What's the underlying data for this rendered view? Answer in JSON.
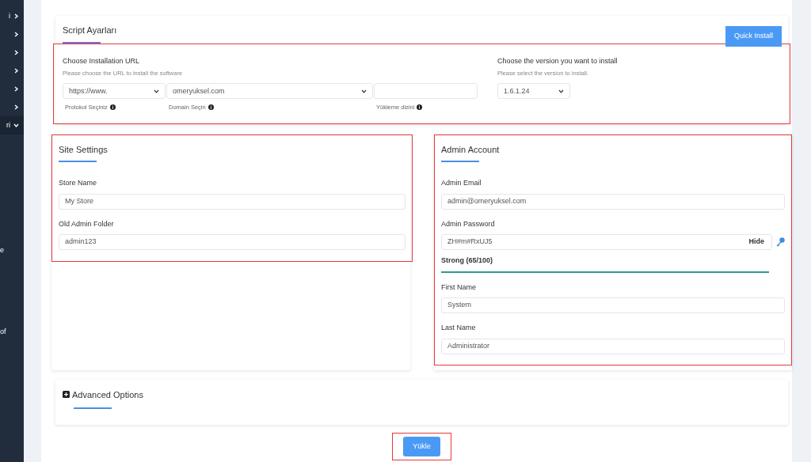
{
  "sidebar": {
    "items": [
      {
        "kind": "menu",
        "label": "i",
        "expanded": false
      },
      {
        "kind": "menu",
        "expanded": false
      },
      {
        "kind": "menu",
        "expanded": false
      },
      {
        "kind": "menu",
        "expanded": false
      },
      {
        "kind": "menu",
        "expanded": false
      },
      {
        "kind": "menu",
        "expanded": false
      },
      {
        "kind": "menu",
        "label": "ri",
        "expanded": true
      },
      {
        "kind": "text",
        "label": "e"
      },
      {
        "kind": "text",
        "label": "of"
      }
    ]
  },
  "script_settings": {
    "title": "Script Ayarları",
    "quick_install": "Quick Install",
    "highlighted": true,
    "url": {
      "title": "Choose Installation URL",
      "subtitle": "Please choose the URL to install the software",
      "fields": [
        {
          "kind": "select",
          "value": "https://www.",
          "help": "Protokol Seçiniz"
        },
        {
          "kind": "select",
          "value": "omeryuksel.com",
          "help": "Domain Seçin"
        },
        {
          "kind": "input",
          "help": "Yükleme dizini"
        }
      ]
    },
    "version": {
      "title": "Choose the version you want to install",
      "subtitle": "Please select the version to install.",
      "value": "1.6.1.24"
    }
  },
  "site_settings": {
    "title": "Site Settings",
    "highlighted": true,
    "fields": [
      {
        "label": "Store Name",
        "value": "My Store"
      },
      {
        "label": "Old Admin Folder",
        "value": "admin123"
      }
    ]
  },
  "admin_account": {
    "title": "Admin Account",
    "highlighted": true,
    "fields": [
      {
        "kind": "text",
        "label": "Admin Email",
        "value": "admin@omeryuksel.com"
      },
      {
        "kind": "password",
        "label": "Admin Password",
        "value": "ZH#m#RxUJ5",
        "toggle": "Hide",
        "strength": "Strong (65/100)",
        "level": 1
      },
      {
        "kind": "text",
        "label": "First Name",
        "value": "System"
      },
      {
        "kind": "text",
        "label": "Last Name",
        "value": "Administrator"
      }
    ]
  },
  "advanced_options": {
    "title": "Advanced Options",
    "expanded": false
  },
  "submit": {
    "label": "Yükle",
    "highlighted": true
  }
}
